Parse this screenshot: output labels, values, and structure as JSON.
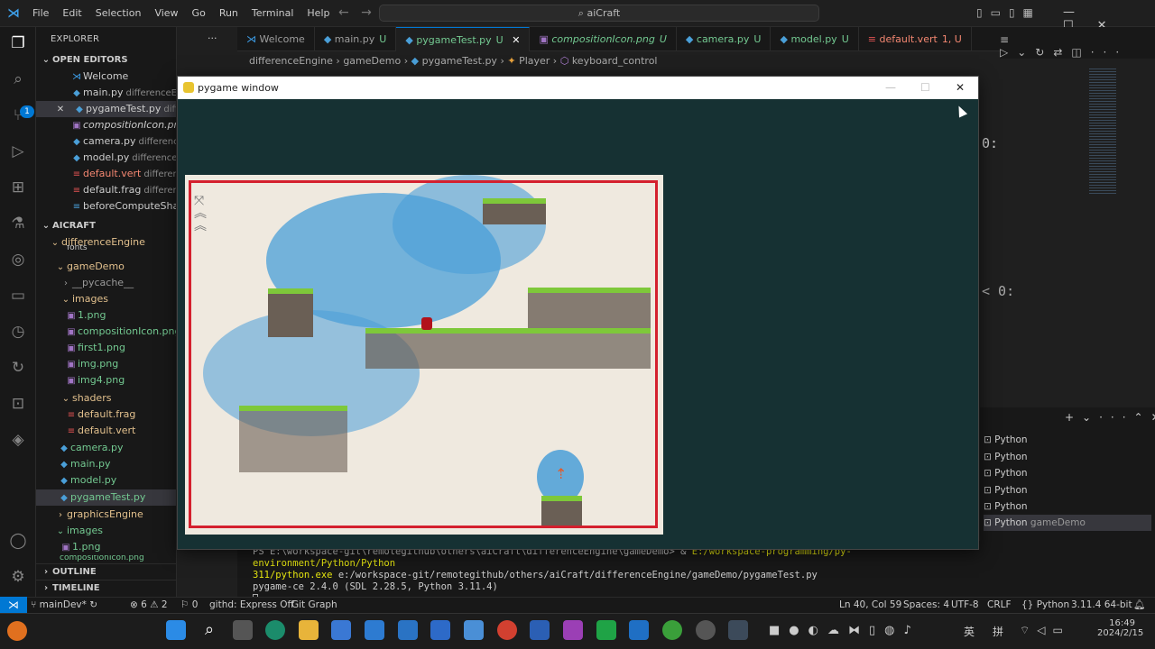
{
  "titlebar": {
    "menu": [
      "File",
      "Edit",
      "Selection",
      "View",
      "Go",
      "Run",
      "Terminal",
      "Help"
    ],
    "search": "aiCraft"
  },
  "sidebar": {
    "title": "EXPLORER",
    "open_editors": "OPEN EDITORS",
    "badge": "1",
    "open_files": [
      {
        "name": "Welcome",
        "desc": ""
      },
      {
        "name": "main.py",
        "desc": "differenceEngine"
      },
      {
        "name": "pygameTest.py",
        "desc": "differenceE"
      },
      {
        "name": "compositionIcon.png",
        "desc": ""
      },
      {
        "name": "camera.py",
        "desc": "differenceEng"
      },
      {
        "name": "model.py",
        "desc": "differenceEng"
      },
      {
        "name": "default.vert",
        "desc": "differenc"
      },
      {
        "name": "default.frag",
        "desc": "differenc"
      },
      {
        "name": "beforeComputeShade",
        "desc": ""
      }
    ],
    "project": "AICRAFT",
    "tree": [
      {
        "name": "differenceEngine",
        "type": "folder"
      },
      {
        "name": "fonts",
        "type": "folder"
      },
      {
        "name": "gameDemo",
        "type": "folder"
      },
      {
        "name": "__pycache__",
        "type": "folder"
      },
      {
        "name": "images",
        "type": "folder"
      },
      {
        "name": "1.png",
        "type": "file"
      },
      {
        "name": "compositionIcon.png",
        "type": "file"
      },
      {
        "name": "first1.png",
        "type": "file"
      },
      {
        "name": "img.png",
        "type": "file"
      },
      {
        "name": "img4.png",
        "type": "file"
      },
      {
        "name": "shaders",
        "type": "folder"
      },
      {
        "name": "default.frag",
        "type": "file"
      },
      {
        "name": "default.vert",
        "type": "file"
      },
      {
        "name": "camera.py",
        "type": "file"
      },
      {
        "name": "main.py",
        "type": "file"
      },
      {
        "name": "model.py",
        "type": "file"
      },
      {
        "name": "pygameTest.py",
        "type": "file"
      },
      {
        "name": "graphicsEngine",
        "type": "folder"
      },
      {
        "name": "images",
        "type": "folder"
      },
      {
        "name": "1.png",
        "type": "file"
      },
      {
        "name": "compositionIcon.png",
        "type": "file"
      }
    ],
    "outline": "OUTLINE",
    "timeline": "TIMELINE"
  },
  "tabs": [
    {
      "label": "Welcome",
      "mark": ""
    },
    {
      "label": "main.py",
      "mark": "U"
    },
    {
      "label": "pygameTest.py",
      "mark": "U"
    },
    {
      "label": "compositionIcon.png",
      "mark": "U"
    },
    {
      "label": "camera.py",
      "mark": "U"
    },
    {
      "label": "model.py",
      "mark": "U"
    },
    {
      "label": "default.vert",
      "mark": "1, U"
    }
  ],
  "breadcrumbs": [
    "differenceEngine",
    "gameDemo",
    "pygameTest.py",
    "Player",
    "keyboard_control"
  ],
  "editor": {
    "code1": "0:",
    "code2": "< 0:"
  },
  "pygame": {
    "title": "pygame window"
  },
  "terminal": {
    "line1_prompt": "PS E:\\workspace-git\\remotegithub\\others\\aiCraft\\differenceEngine\\gameDemo> & ",
    "line1_cmd": "E:/workspace-programming/py-environment/Python/Python",
    "line2_cmd": "311/python.exe",
    "line2_rest": " e:/workspace-git/remotegithub/others/aiCraft/differenceEngine/gameDemo/pygameTest.py",
    "line3": "pygame-ce 2.4.0 (SDL 2.28.5, Python 3.11.4)",
    "sessions": [
      "Python",
      "Python",
      "Python",
      "Python",
      "Python",
      "Python"
    ],
    "last_session_desc": "gameDemo"
  },
  "status": {
    "branch": "mainDev*",
    "problems": "⊗ 6 ⚠ 2",
    "ports": "⚐ 0",
    "githd": "githd: Express Off",
    "gitgraph": "Git Graph",
    "position": "Ln 40, Col 59",
    "spaces": "Spaces: 4",
    "encoding": "UTF-8",
    "eol": "CRLF",
    "language": "Python",
    "interpreter": "3.11.4 64-bit"
  },
  "taskbar": {
    "time": "16:49",
    "date": "2024/2/15",
    "ime": "英",
    "ime2": "拼"
  }
}
